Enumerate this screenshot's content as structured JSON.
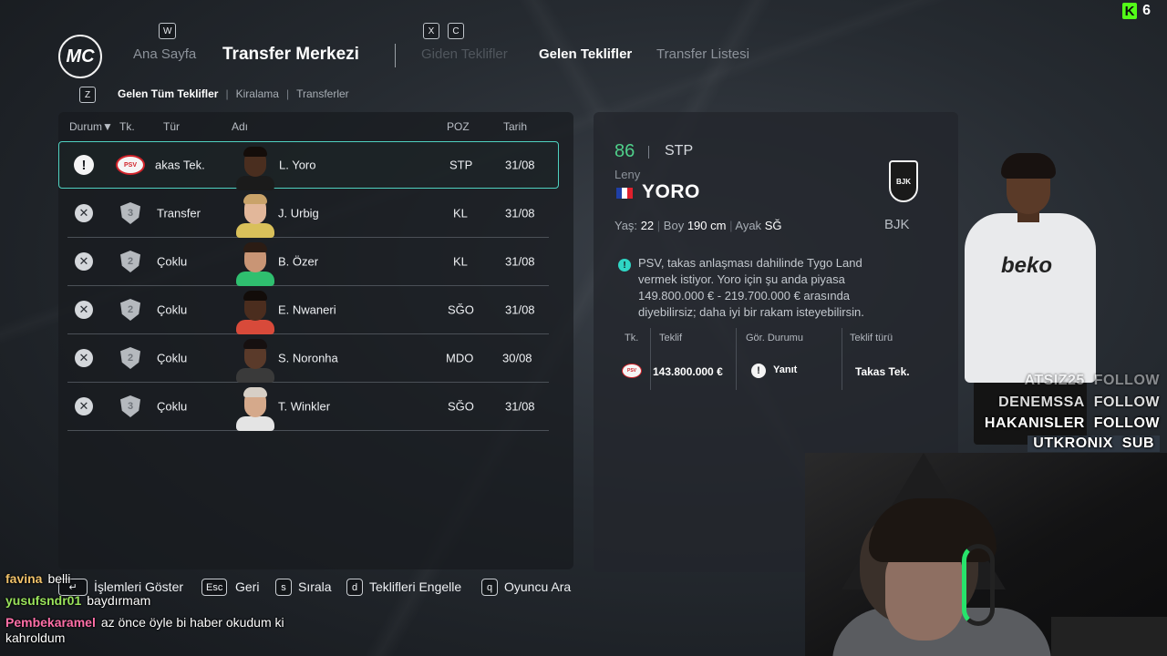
{
  "header": {
    "logo_text": "MC",
    "keys": {
      "prev": "W",
      "x": "X",
      "c": "C",
      "z": "Z"
    },
    "nav": [
      "Ana Sayfa",
      "Transfer Merkezi",
      "Giden Teklifler",
      "Gelen Teklifler",
      "Transfer Listesi"
    ],
    "subnav": [
      "Gelen Tüm Teklifler",
      "Kiralama",
      "Transferler"
    ],
    "kick_count": "6"
  },
  "list": {
    "columns": [
      "Durum",
      "Tk.",
      "Tür",
      "Adı",
      "POZ",
      "Tarih"
    ],
    "sort_indicator": "▼",
    "rows": [
      {
        "status": "alert",
        "club": "PSV",
        "type": "akas Tek.",
        "name": "L. Yoro",
        "pos": "STP",
        "date": "31/08",
        "skin": "#4a2e1f",
        "hair": "#140d0a",
        "shirt": "#1b1b1b"
      },
      {
        "status": "x",
        "club": "3",
        "type": "Transfer",
        "name": "J. Urbig",
        "pos": "KL",
        "date": "31/08",
        "skin": "#e2b79a",
        "hair": "#c9a36a",
        "shirt": "#d9c05a"
      },
      {
        "status": "x",
        "club": "2",
        "type": "Çoklu",
        "name": "B. Özer",
        "pos": "KL",
        "date": "31/08",
        "skin": "#c99575",
        "hair": "#2b1c14",
        "shirt": "#2fbf6f"
      },
      {
        "status": "x",
        "club": "2",
        "type": "Çoklu",
        "name": "E. Nwaneri",
        "pos": "SĞO",
        "date": "31/08",
        "skin": "#4b2d1e",
        "hair": "#120c09",
        "shirt": "#d84a3a"
      },
      {
        "status": "x",
        "club": "2",
        "type": "Çoklu",
        "name": "S. Noronha",
        "pos": "MDO",
        "date": "30/08",
        "skin": "#5a3a2a",
        "hair": "#161010",
        "shirt": "#3a3a3a"
      },
      {
        "status": "x",
        "club": "3",
        "type": "Çoklu",
        "name": "T. Winkler",
        "pos": "SĞO",
        "date": "31/08",
        "skin": "#d5a98b",
        "hair": "#d7cfc6",
        "shirt": "#e4e4e4"
      }
    ]
  },
  "detail": {
    "rating": "86",
    "position": "STP",
    "first_name": "Leny",
    "last_name": "YORO",
    "age_label": "Yaş:",
    "age": "22",
    "height_label": "Boy",
    "height": "190 cm",
    "foot_label": "Ayak",
    "foot": "SĞ",
    "club_code": "BJK",
    "club_crest": "BJK",
    "message": [
      "PSV, takas anlaşması dahilinde Tygo Land",
      "vermek istiyor. Yoro için şu anda piyasa",
      "149.800.000 € - 219.700.000 € arasında",
      "diyebilirsiz; daha iyi bir rakam isteyebilirsin."
    ],
    "offer_table": {
      "headers": [
        "Tk.",
        "Teklif",
        "Gör. Durumu",
        "Teklif türü"
      ],
      "club": "PSV",
      "amount": "143.800.000 €",
      "status": "Yanıt",
      "type": "Takas Tek."
    },
    "flag_colors": [
      "#1f3fa6",
      "#ffffff",
      "#e0202c"
    ]
  },
  "player_figure": {
    "sponsor": "beko"
  },
  "overlay": {
    "follows": [
      {
        "name": "ATSIZ25",
        "action": "FOLLOW"
      },
      {
        "name": "DENEMSSA",
        "action": "FOLLOW"
      },
      {
        "name": "HAKANISLER",
        "action": "FOLLOW"
      },
      {
        "name": "UTKRONIX",
        "action": "SUB"
      }
    ]
  },
  "chat": [
    {
      "user": "favina",
      "color": "#f1c26a",
      "message": "belli"
    },
    {
      "user": "yusufsndr01",
      "color": "#9ae35b",
      "message": "baydırmam"
    },
    {
      "user": "Pembekaramel",
      "color": "#ff6fa8",
      "message": "az önce öyle bi haber okudum ki kahroldum"
    }
  ],
  "hints": [
    {
      "key": "↵",
      "label": "İşlemleri Göster"
    },
    {
      "key": "Esc",
      "label": "Geri"
    },
    {
      "key": "s",
      "label": "Sırala"
    },
    {
      "key": "d",
      "label": "Teklifleri Engelle"
    },
    {
      "key": "q",
      "label": "Oyuncu Ara"
    }
  ]
}
